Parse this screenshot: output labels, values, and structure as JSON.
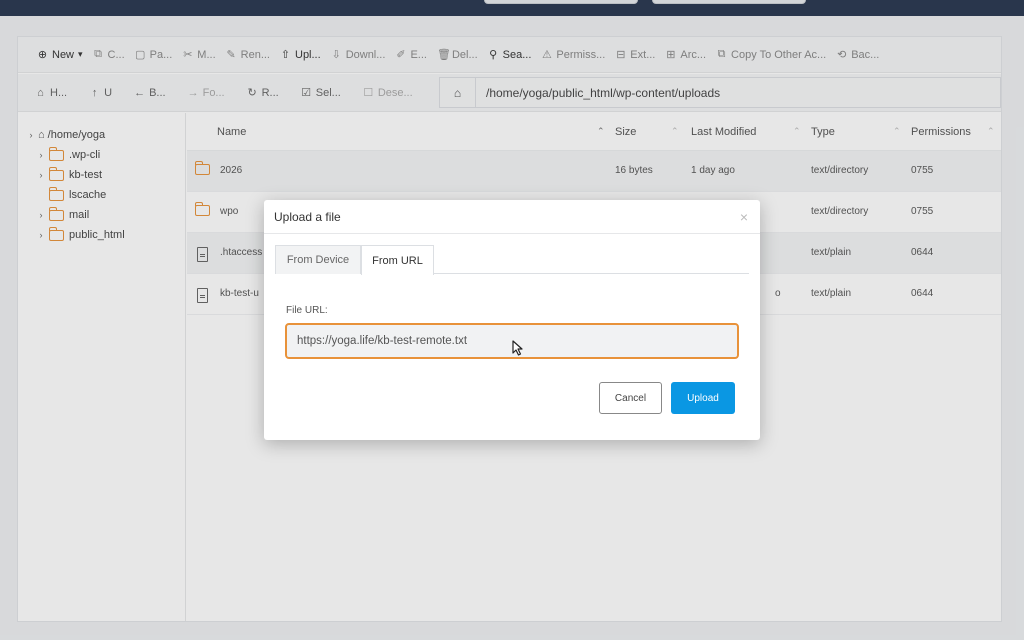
{
  "toolbar_primary": [
    {
      "icon": "plus-circle-icon",
      "label": "New"
    },
    {
      "icon": "copy-icon",
      "label": "C..."
    },
    {
      "icon": "paste-icon",
      "label": "Pa..."
    },
    {
      "icon": "scissors-icon",
      "label": "M..."
    },
    {
      "icon": "pencil-icon",
      "label": "Ren..."
    },
    {
      "icon": "upload-icon",
      "label": "Upl..."
    },
    {
      "icon": "download-icon",
      "label": "Downl..."
    },
    {
      "icon": "edit-icon",
      "label": "E..."
    },
    {
      "icon": "trash-icon",
      "label": "Del..."
    },
    {
      "icon": "search-icon",
      "label": "Sea..."
    },
    {
      "icon": "warning-icon",
      "label": "Permiss..."
    },
    {
      "icon": "extract-icon",
      "label": "Ext..."
    },
    {
      "icon": "archive-icon",
      "label": "Arc..."
    },
    {
      "icon": "copy-account-icon",
      "label": "Copy To Other Ac..."
    },
    {
      "icon": "backup-icon",
      "label": "Bac..."
    }
  ],
  "toolbar_secondary": [
    {
      "icon": "home-icon",
      "label": "H..."
    },
    {
      "icon": "arrow-up-icon",
      "label": "U"
    },
    {
      "icon": "arrow-left-icon",
      "label": "B..."
    },
    {
      "icon": "arrow-right-icon",
      "label": "Fo..."
    },
    {
      "icon": "refresh-icon",
      "label": "R..."
    },
    {
      "icon": "check-square-icon",
      "label": "Sel..."
    },
    {
      "icon": "square-icon",
      "label": "Dese..."
    }
  ],
  "path": "/home/yoga/public_html/wp-content/uploads",
  "tree": {
    "root": "/home/yoga",
    "children": [
      ".wp-cli",
      "kb-test",
      "lscache",
      "mail",
      "public_html"
    ]
  },
  "columns": {
    "name": "Name",
    "size": "Size",
    "modified": "Last Modified",
    "type": "Type",
    "permissions": "Permissions"
  },
  "files": [
    {
      "name": "2026",
      "size": "16 bytes",
      "modified": "1 day ago",
      "type": "text/directory",
      "perm": "0755",
      "kind": "folder"
    },
    {
      "name": "wpo",
      "size": "",
      "modified": "",
      "type": "text/directory",
      "perm": "0755",
      "kind": "folder"
    },
    {
      "name": ".htaccess",
      "size": "",
      "modified": "",
      "type": "text/plain",
      "perm": "0644",
      "kind": "file"
    },
    {
      "name": "kb-test-u",
      "size": "",
      "modified": "o",
      "type": "text/plain",
      "perm": "0644",
      "kind": "file"
    }
  ],
  "modal": {
    "title": "Upload a file",
    "close": "×",
    "tabs": [
      "From Device",
      "From URL"
    ],
    "active_tab": "From URL",
    "url_label": "File URL:",
    "url_value": "https://yoga.life/kb-test-remote.txt",
    "cancel": "Cancel",
    "upload": "Upload"
  },
  "colors": {
    "accent": "#e8923a",
    "primary": "#0a97e3",
    "topbar": "#27364f"
  }
}
